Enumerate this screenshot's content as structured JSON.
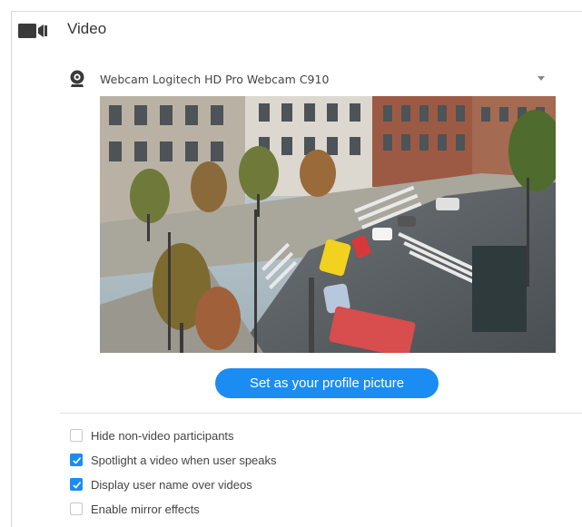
{
  "section": {
    "icon": "video-camera-icon",
    "title": "Video"
  },
  "webcam": {
    "icon": "webcam-icon",
    "selected": "Webcam Logitech HD Pro Webcam C910",
    "dropdown_icon": "caret-down-icon"
  },
  "preview": {
    "description_icon": "video-preview"
  },
  "profile_button": {
    "label": "Set as your profile picture",
    "color": "#1b8cf2"
  },
  "options": [
    {
      "label": "Hide non-video participants",
      "checked": false
    },
    {
      "label": "Spotlight a video when user speaks",
      "checked": true
    },
    {
      "label": "Display user name over videos",
      "checked": true
    },
    {
      "label": "Enable mirror effects",
      "checked": false
    }
  ],
  "colors": {
    "accent": "#1b8cf2",
    "text": "#444444",
    "icon": "#3a3a3a"
  }
}
